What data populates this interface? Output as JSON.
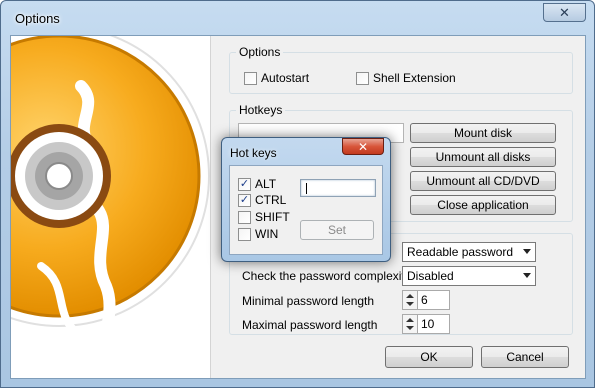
{
  "window": {
    "title": "Options",
    "close_glyph": "✕"
  },
  "options_group": {
    "label": "Options",
    "autostart": {
      "label": "Autostart",
      "checked": false
    },
    "shell_extension": {
      "label": "Shell Extension",
      "checked": false
    }
  },
  "hotkeys_group": {
    "label": "Hotkeys",
    "buttons": {
      "mount": "Mount disk",
      "unmount_all_disks": "Unmount all disks",
      "unmount_all_cd": "Unmount all CD/DVD",
      "close_app": "Close application"
    }
  },
  "password_group": {
    "password_mode": "Readable password",
    "complexity_label": "Check the password complexity",
    "complexity_value": "Disabled",
    "min_label": "Minimal password length",
    "min_value": "6",
    "max_label": "Maximal password length",
    "max_value": "10"
  },
  "footer": {
    "ok": "OK",
    "cancel": "Cancel"
  },
  "hotkeys_dialog": {
    "title": "Hot keys",
    "close_glyph": "✕",
    "modifiers": [
      {
        "label": "ALT",
        "checked": true
      },
      {
        "label": "CTRL",
        "checked": true
      },
      {
        "label": "SHIFT",
        "checked": false
      },
      {
        "label": "WIN",
        "checked": false
      }
    ],
    "key_value": "",
    "set_label": "Set"
  },
  "colors": {
    "accent_blue": "#a9c6e2",
    "disc_orange": "#f5a623",
    "close_red": "#c23a1f"
  }
}
